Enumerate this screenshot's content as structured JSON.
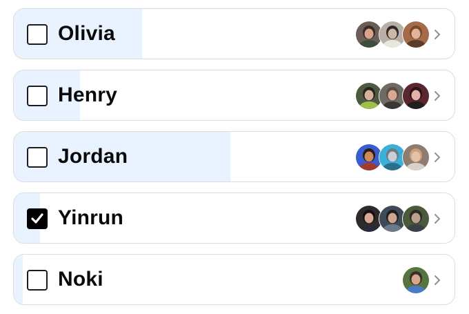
{
  "rows": [
    {
      "name": "Olivia",
      "checked": false,
      "progress": 0.29,
      "avatars": [
        {
          "bg": "#6b5e58",
          "skin": "#d6a48c",
          "hair": "#3a2b24",
          "shirt": "#3d4e3e"
        },
        {
          "bg": "#b7b0a6",
          "skin": "#cdb7a4",
          "hair": "#2f2a28",
          "shirt": "#e9e6e0"
        },
        {
          "bg": "#a56a4a",
          "skin": "#e3b49a",
          "hair": "#7a4a2c",
          "shirt": "#5b3b2a"
        }
      ]
    },
    {
      "name": "Henry",
      "checked": false,
      "progress": 0.15,
      "avatars": [
        {
          "bg": "#4c5a40",
          "skin": "#d8b19c",
          "hair": "#2a2420",
          "shirt": "#9fbf4a"
        },
        {
          "bg": "#6e6a66",
          "skin": "#d8a892",
          "hair": "#5b4b44",
          "shirt": "#3a3636"
        },
        {
          "bg": "#5a2630",
          "skin": "#e2b3a6",
          "hair": "#2a1416",
          "shirt": "#202020"
        }
      ]
    },
    {
      "name": "Jordan",
      "checked": false,
      "progress": 0.49,
      "avatars": [
        {
          "bg": "#3a5dcf",
          "skin": "#c98b5c",
          "hair": "#2e1c14",
          "shirt": "#a33a2a"
        },
        {
          "bg": "#3ab0d8",
          "skin": "#c8cfd6",
          "hair": "#6d7a86",
          "shirt": "#2a6f8e"
        },
        {
          "bg": "#8e7c70",
          "skin": "#e6c2a8",
          "hair": "#c9a27a",
          "shirt": "#d9d2c8"
        }
      ]
    },
    {
      "name": "Yinrun",
      "checked": true,
      "progress": 0.06,
      "avatars": [
        {
          "bg": "#2f2a2a",
          "skin": "#d9a894",
          "hair": "#141012",
          "shirt": "#2a2a3a"
        },
        {
          "bg": "#3f4a58",
          "skin": "#cfa58e",
          "hair": "#1e1e22",
          "shirt": "#6a7a8a"
        },
        {
          "bg": "#4a5a3a",
          "skin": "#b9a08c",
          "hair": "#2a2a2a",
          "shirt": "#3a3f48"
        }
      ]
    },
    {
      "name": "Noki",
      "checked": false,
      "progress": 0.02,
      "avatars": [
        {
          "bg": "#56743f",
          "skin": "#d7a78c",
          "hair": "#3a2e28",
          "shirt": "#4a7ac8"
        }
      ]
    }
  ],
  "icons": {
    "checkbox": "checkbox-icon",
    "checkmark": "checkmark-icon",
    "chevron": "chevron-right-icon"
  },
  "colors": {
    "progress_fill": "#e8f3ff",
    "border": "#dcdcdf",
    "chevron": "#8e8e93",
    "text": "#0a0a0a"
  }
}
